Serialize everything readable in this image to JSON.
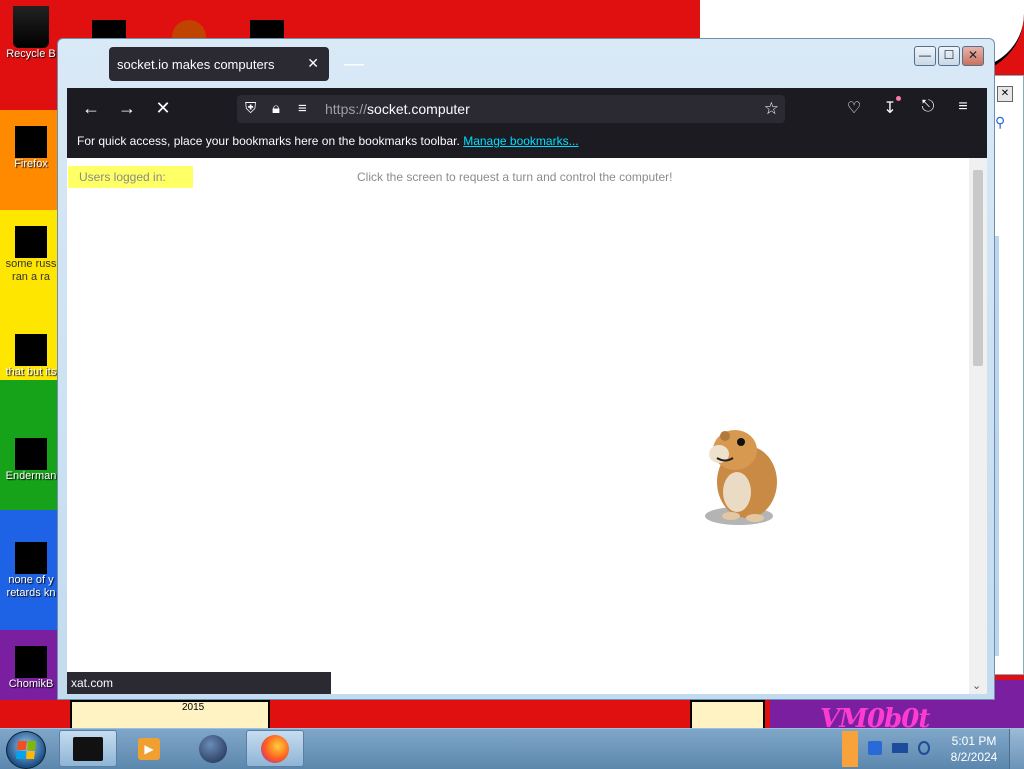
{
  "desktop": {
    "icons": [
      {
        "label": "Recycle B"
      },
      {
        "label": "Firefox"
      },
      {
        "label": "some russ ran a ra"
      },
      {
        "label": "that but its"
      },
      {
        "label": "Enderman"
      },
      {
        "label": "none of y retards kn"
      },
      {
        "label": "ChomikB"
      }
    ],
    "wallpaper_text": "2015",
    "wallpaper_scrawl": "VM0b0t"
  },
  "browser": {
    "tab_title": "socket.io makes computers",
    "url_scheme": "https://",
    "url_host": "socket.computer",
    "bookmarks_message": "For quick access, place your bookmarks here on the bookmarks toolbar.",
    "bookmarks_link": "Manage bookmarks...",
    "status_url": "xat.com",
    "window_controls": {
      "minimize": "—",
      "maximize": "☐",
      "close": "✕"
    }
  },
  "page": {
    "users_label": "Users logged in:",
    "instruction": "Click the screen to request a turn and control the computer!"
  },
  "taskbar": {
    "time": "5:01 PM",
    "date": "8/2/2024"
  },
  "colors": {
    "firefox_dark": "#1c1b22",
    "url_bar": "#2b2a33",
    "link": "#00ddff",
    "users_highlight": "#ffff66"
  }
}
